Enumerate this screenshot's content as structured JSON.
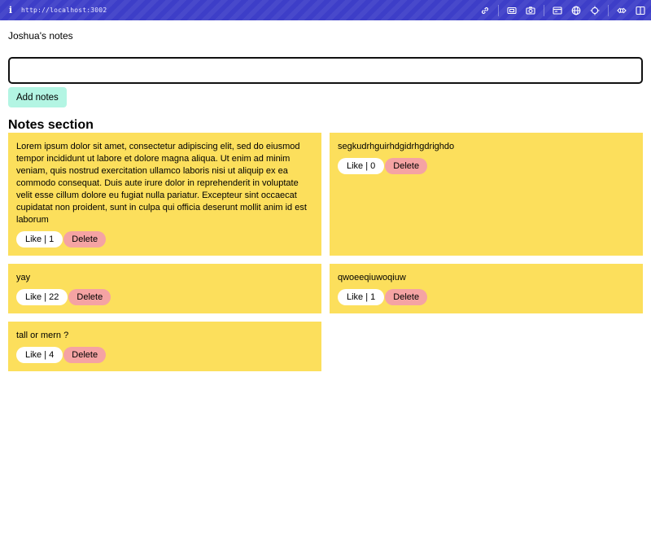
{
  "browser": {
    "url": "http://localhost:3002",
    "info_glyph": "i",
    "toolbar_icons": [
      "link-icon",
      "screenshot-icon",
      "camera-icon",
      "window-icon",
      "globe-icon",
      "crosshair-icon",
      "expand-icon",
      "sidebar-icon"
    ]
  },
  "app": {
    "title": "Joshua's notes",
    "input": {
      "value": "",
      "placeholder": ""
    },
    "add_button_label": "Add notes",
    "section_title": "Notes section"
  },
  "notes": [
    {
      "text": "Lorem ipsum dolor sit amet, consectetur adipiscing elit, sed do eiusmod tempor incididunt ut labore et dolore magna aliqua. Ut enim ad minim veniam, quis nostrud exercitation ullamco laboris nisi ut aliquip ex ea commodo consequat. Duis aute irure dolor in reprehenderit in voluptate velit esse cillum dolore eu fugiat nulla pariatur. Excepteur sint occaecat cupidatat non proident, sunt in culpa qui officia deserunt mollit anim id est laborum",
      "like_label": "Like | 1",
      "delete_label": "Delete"
    },
    {
      "text": "segkudrhguirhdgidrhgdrighdo",
      "like_label": "Like | 0",
      "delete_label": "Delete"
    },
    {
      "text": "yay",
      "like_label": "Like | 22",
      "delete_label": "Delete"
    },
    {
      "text": "qwoeeqiuwoqiuw",
      "like_label": "Like | 1",
      "delete_label": "Delete"
    },
    {
      "text": "tall or mern ?",
      "like_label": "Like | 4",
      "delete_label": "Delete"
    }
  ],
  "colors": {
    "browser_bar": "#3d3ec8",
    "note_card": "#fcdf5c",
    "add_button": "#b3f5e3",
    "like_button": "#ffffff",
    "delete_button": "#f5a3a3"
  }
}
